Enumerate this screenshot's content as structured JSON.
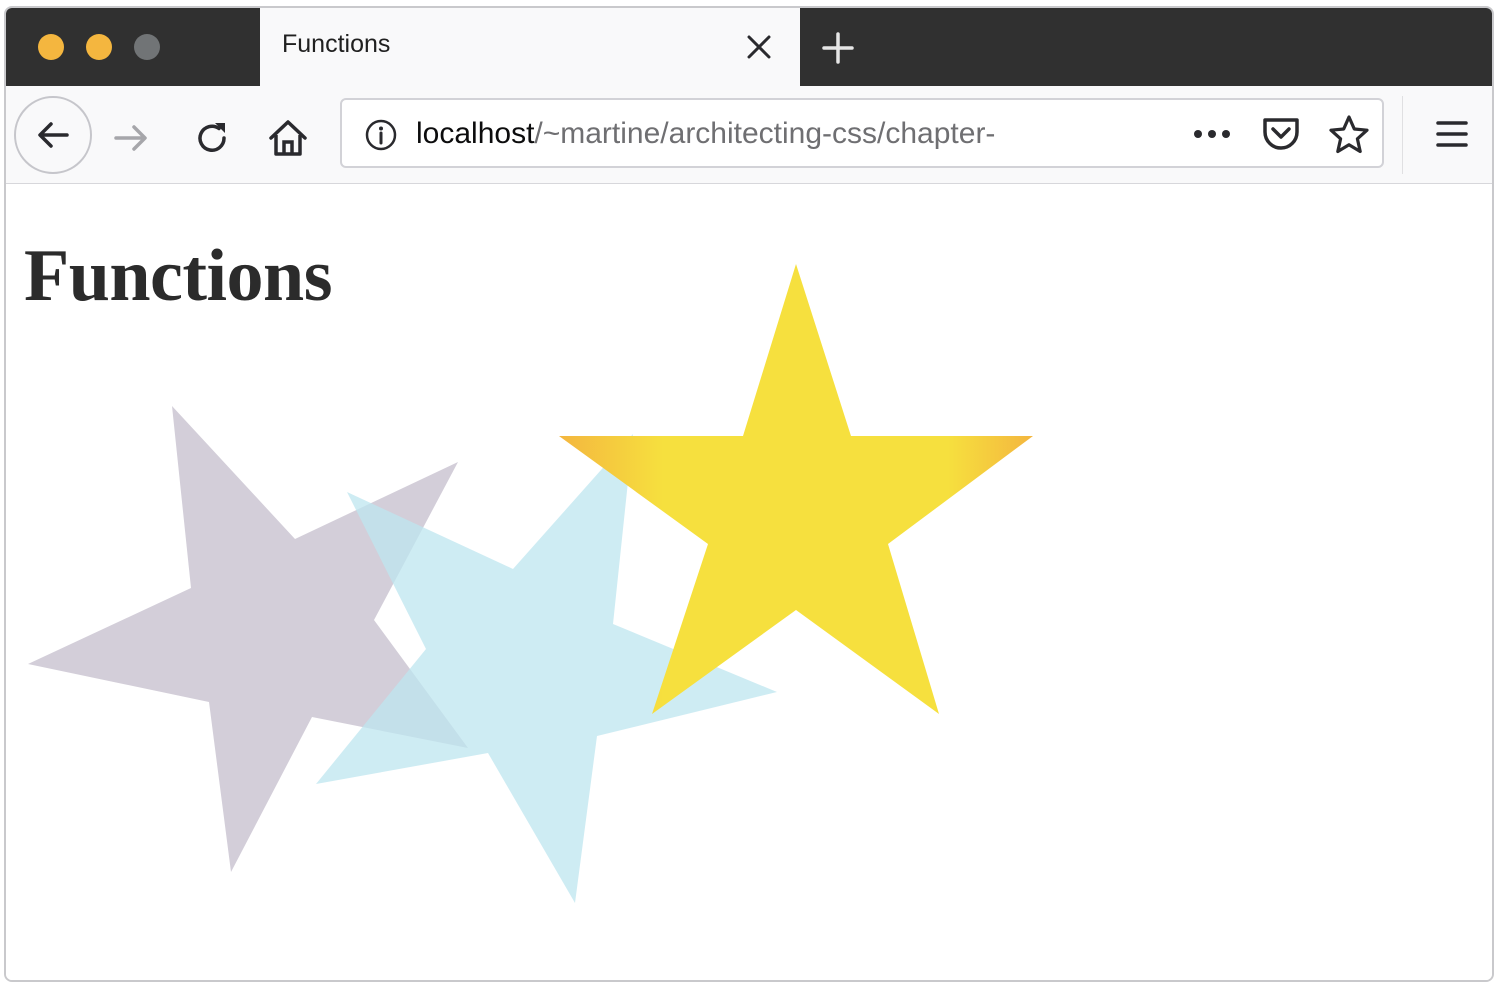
{
  "window": {
    "traffic_colors": [
      "#f4b63f",
      "#f4b63f",
      "#717476"
    ]
  },
  "tab": {
    "title": "Functions"
  },
  "toolbar": {
    "url_host": "localhost",
    "url_path": "/~martine/architecting-css/chapter-"
  },
  "page": {
    "heading": "Functions",
    "stars": [
      {
        "name": "lavender-star",
        "fill": "#d3ced9",
        "opacity": 1
      },
      {
        "name": "light-blue-star",
        "fill": "#bde6ef",
        "opacity": 0.75
      },
      {
        "name": "yellow-star",
        "fill": "#f6e03e",
        "gradient_edge": "#f4b63f",
        "opacity": 1
      }
    ]
  },
  "icons": {
    "back": "arrow-left-icon",
    "forward": "arrow-right-icon",
    "reload": "reload-icon",
    "home": "home-icon",
    "info": "info-icon",
    "more": "more-dots-icon",
    "pocket": "pocket-icon",
    "bookmark": "star-outline-icon",
    "menu": "hamburger-menu-icon",
    "close": "close-icon",
    "new_tab": "plus-icon"
  }
}
